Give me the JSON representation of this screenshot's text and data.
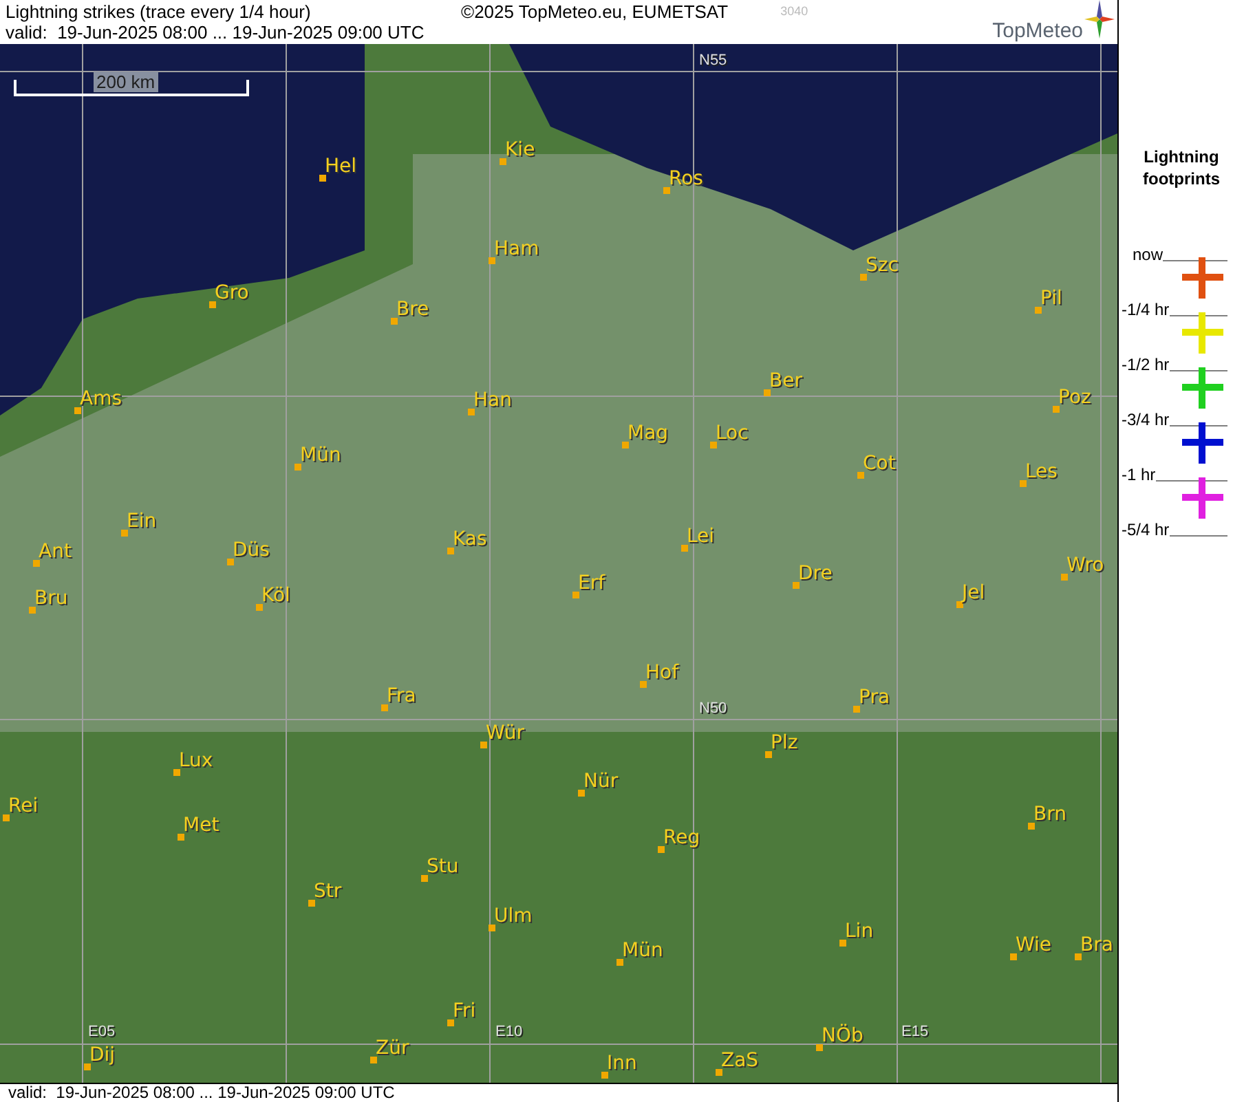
{
  "header": {
    "title": "Lightning strikes (trace every 1/4 hour)",
    "copyright": "©2025 TopMeteo.eu, EUMETSAT",
    "code": "3040",
    "valid": "valid:  19-Jun-2025 08:00 ... 19-Jun-2025 09:00 UTC",
    "logo": "TopMeteo"
  },
  "map": {
    "scale": "200 km",
    "grid_labels": [
      "N55",
      "N50",
      "E05",
      "E10",
      "E15"
    ],
    "cities": [
      "Hel",
      "Kie",
      "Ros",
      "Ham",
      "Szc",
      "Gro",
      "Bre",
      "Pil",
      "Ams",
      "Han",
      "Ber",
      "Poz",
      "Mün",
      "Mag",
      "Loc",
      "Cot",
      "Les",
      "Ein",
      "Ant",
      "Düs",
      "Kas",
      "Lei",
      "Bru",
      "Köl",
      "Erf",
      "Dre",
      "Jel",
      "Wro",
      "Hof",
      "Fra",
      "Pra",
      "Wür",
      "Lux",
      "Plz",
      "Nür",
      "Rei",
      "Met",
      "Reg",
      "Brn",
      "Stu",
      "Str",
      "Ulm",
      "Mün",
      "Lin",
      "Wie",
      "Bra",
      "Fri",
      "Dij",
      "Zür",
      "Inn",
      "ZaS",
      "NÖb"
    ]
  },
  "legend": {
    "title": "Lightning footprints",
    "times": [
      "now",
      "-1/4 hr",
      "-1/2 hr",
      "-3/4 hr",
      "-1 hr",
      "-5/4 hr"
    ],
    "markers": [
      {
        "color": "#e05010"
      },
      {
        "color": "#e8e800"
      },
      {
        "color": "#20d020"
      },
      {
        "color": "#0010d0"
      },
      {
        "color": "#e020e0"
      }
    ]
  },
  "status_bar": {
    "valid": "valid:  19-Jun-2025 08:00 ... 19-Jun-2025 09:00 UTC"
  }
}
